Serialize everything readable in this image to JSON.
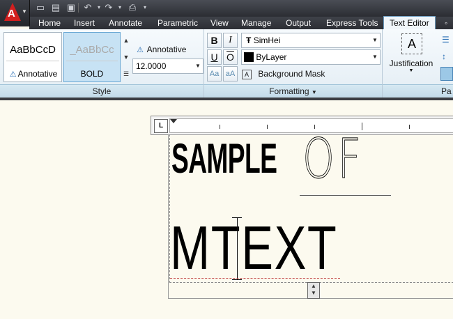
{
  "quick_access": [
    "new-icon",
    "open-icon",
    "save-icon",
    "undo-icon",
    "redo-icon",
    "plot-icon"
  ],
  "tabs": [
    {
      "label": "Home",
      "active": false
    },
    {
      "label": "Insert",
      "active": false
    },
    {
      "label": "Annotate",
      "active": false
    },
    {
      "label": "Parametric",
      "active": false
    },
    {
      "label": "View",
      "active": false
    },
    {
      "label": "Manage",
      "active": false
    },
    {
      "label": "Output",
      "active": false
    },
    {
      "label": "Express Tools",
      "active": false
    },
    {
      "label": "Text Editor",
      "active": true
    }
  ],
  "style_panel": {
    "title": "Style",
    "style1": {
      "sample": "AaBbCcD",
      "label": "Annotative"
    },
    "style2": {
      "sample": "_AaBbCc",
      "label": "BOLD",
      "selected": true
    },
    "annotative_label": "Annotative",
    "text_height": "12.0000"
  },
  "formatting_panel": {
    "title": "Formatting",
    "bold": "B",
    "italic": "I",
    "underline": "U",
    "overline": "O",
    "uppercase": "Aa",
    "lowercase": "aA",
    "font": "SimHei",
    "color": "ByLayer",
    "color_swatch": "#000000",
    "background_mask": "Background Mask"
  },
  "paragraph_panel": {
    "justification": "Justification",
    "title_partial": "Pa"
  },
  "ruler": {
    "tab_label": "L"
  },
  "canvas": {
    "line1_part1": "SAMPLE",
    "line1_part2": "OF",
    "line2": "MTEXT"
  }
}
